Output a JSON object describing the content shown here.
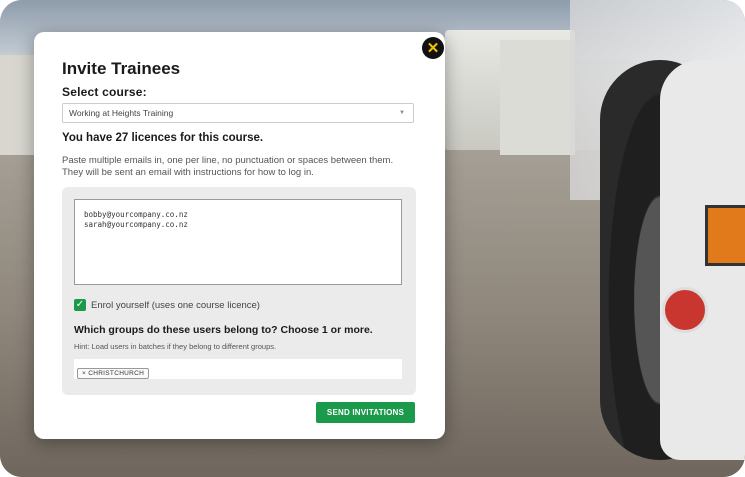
{
  "modal": {
    "title": "Invite Trainees",
    "close_icon": "close-icon",
    "select_course_label": "Select course:",
    "course_select": {
      "value": "Working at Heights Training",
      "options": [
        "Working at Heights Training"
      ]
    },
    "licences_text": "You have 27 licences for this course.",
    "help_text": "Paste multiple emails in, one per line, no punctuation or spaces between them. They will be sent an email with instructions for how to log in.",
    "emails_text": "bobby@yourcompany.co.nz\nsarah@yourcompany.co.nz",
    "enrol_checkbox": {
      "checked": true,
      "label": "Enrol yourself (uses one course licence)"
    },
    "groups_question": "Which groups do these users belong to? Choose 1 or more.",
    "groups_hint": "Hint: Load users in batches if they belong to different groups.",
    "group_tags": [
      "× CHRISTCHURCH"
    ],
    "send_button": "SEND INVITATIONS"
  },
  "colors": {
    "accent_green": "#1b9a4b",
    "close_yellow": "#f2c300"
  }
}
